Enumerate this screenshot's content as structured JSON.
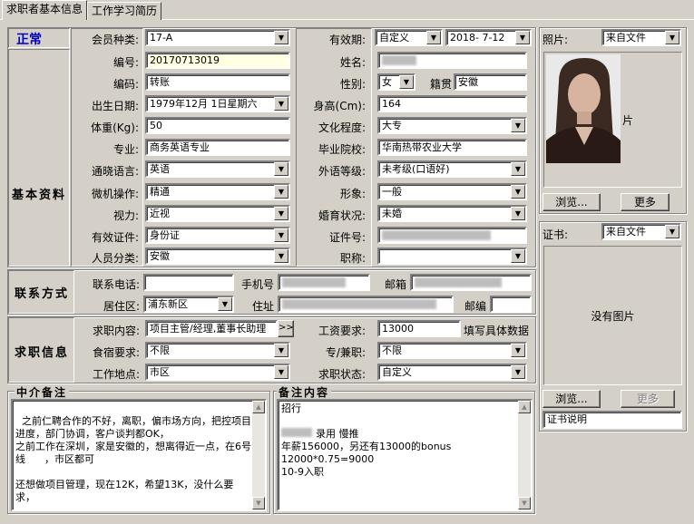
{
  "tabs": [
    "求职者基本信息",
    "工作学习简历"
  ],
  "status": "正常",
  "basic": {
    "section_title": "基本资料",
    "member_type_label": "会员种类:",
    "member_type": "17-A",
    "validity_label": "有效期:",
    "validity_mode": "自定义",
    "validity_date": "2018- 7-12",
    "id_label": "编号:",
    "id": "20170713019",
    "name_label": "姓名:",
    "name": "",
    "code_label": "编码:",
    "code": "转账",
    "gender_label": "性别:",
    "gender": "女",
    "native_label": "籍贯",
    "native": "安徽",
    "birth_label": "出生日期:",
    "birth": "1979年12月 1日星期六",
    "height_label": "身高(Cm):",
    "height": "164",
    "weight_label": "体重(Kg):",
    "weight": "50",
    "edu_label": "文化程度:",
    "edu": "大专",
    "major_label": "专业:",
    "major": "商务英语专业",
    "school_label": "毕业院校:",
    "school": "华南热带农业大学",
    "lang_label": "通晓语言:",
    "lang": "英语",
    "foreign_label": "外语等级:",
    "foreign": "未考级(口语好)",
    "pc_label": "微机操作:",
    "pc": "精通",
    "image_label": "形象:",
    "image": "一般",
    "vision_label": "视力:",
    "vision": "近视",
    "marital_label": "婚育状况:",
    "marital": "未婚",
    "idtype_label": "有效证件:",
    "idtype": "身份证",
    "idno_label": "证件号:",
    "category_label": "人员分类:",
    "category": "安徽",
    "title_label": "职称:",
    "title": ""
  },
  "contact": {
    "section_title": "联系方式",
    "phone_label": "联系电话:",
    "mobile_label": "手机号",
    "email_label": "邮箱",
    "district_label": "居住区:",
    "district": "浦东新区",
    "address_label": "住址",
    "zip_label": "邮编"
  },
  "job": {
    "section_title": "求职信息",
    "content_label": "求职内容:",
    "content": "项目主管/经理,董事长助理",
    "salary_label": "工资要求:",
    "salary": "13000",
    "salary_hint": "填写具体数据",
    "board_label": "食宿要求:",
    "board": "不限",
    "parttime_label": "专/兼职:",
    "parttime": "不限",
    "location_label": "工作地点:",
    "location": "市区",
    "jobstatus_label": "求职状态:",
    "jobstatus": "自定义"
  },
  "agent_notes": {
    "title": "中介备注",
    "text": "之前仁聘合作的不好，离职，偏市场方向，把控项目进度，部门协调，客户谈判都OK，\n之前工作在深圳，家是安徽的，想离得近一点，在6号线      ，市区都可\n\n还想做项目管理，现在12K，希望13K，没什么要求，"
  },
  "remarks": {
    "title": "备注内容",
    "line1": "招行",
    "line2": "录用  慢推",
    "line3": "年薪156000，另还有13000的bonus",
    "line4": "12000*0.75=9000",
    "line5": "10-9入职"
  },
  "photo": {
    "label": "照片:",
    "source": "来自文件",
    "caption": "片",
    "browse": "浏览...",
    "more": "更多"
  },
  "certificate": {
    "label": "证书:",
    "source": "来自文件",
    "empty": "没有图片",
    "browse": "浏览...",
    "more": "更多",
    "desc": "证书说明"
  },
  "colors": {
    "status": "#0000c0",
    "panel_bg": "#d4d0c8",
    "input_yellow": "#ffffe1"
  }
}
